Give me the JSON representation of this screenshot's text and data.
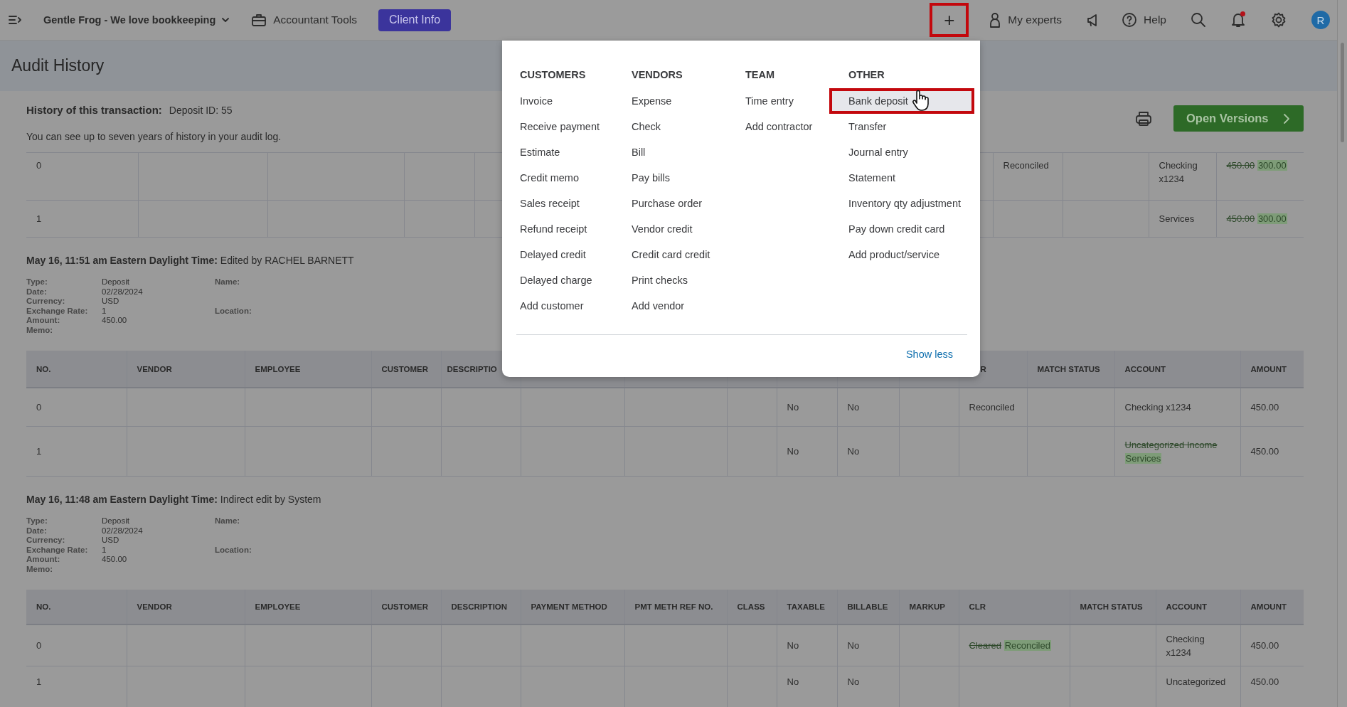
{
  "top_bar": {
    "company": "Gentle Frog - We love bookkeeping",
    "tools": "Accountant Tools",
    "client_button": "Client Info",
    "new_button": {
      "label": "+",
      "highlighted": true
    },
    "experts": "My experts",
    "help": "Help",
    "has_notification": true,
    "avatar": "R"
  },
  "page": {
    "title": "Audit History"
  },
  "history": {
    "label": "History of this transaction:",
    "id": "Deposit ID: 55",
    "note": "You can see up to seven years of history in your audit log.",
    "open_button": "Open Versions"
  },
  "first_table": {
    "rows": [
      [
        "0",
        null,
        null,
        null,
        null,
        "Reconciled",
        null,
        "Checking x1234",
        {
          "old": "450.00",
          "new": "300.00"
        }
      ],
      [
        "1",
        null,
        null,
        null,
        null,
        null,
        null,
        "Services",
        {
          "old": "450.00",
          "new": "300.00"
        }
      ]
    ]
  },
  "entries": [
    {
      "heading": "**May 16, 11:51 am Eastern Daylight Time:** Edited by RACHEL BARNETT",
      "details": [
        {
          "label": "Type:",
          "value": "Deposit",
          "aside": "Name:"
        },
        {
          "label": "Date:",
          "value": "02/28/2024"
        },
        {
          "label": "Currency:",
          "value": "USD"
        },
        {
          "label": "Exchange Rate:",
          "value": "1",
          "aside": "Location:"
        },
        {
          "label": "Amount:",
          "value": "450.00"
        },
        {
          "label": "Memo:"
        }
      ],
      "table": {
        "columns": [
          "NO.",
          "VENDOR",
          "EMPLOYEE",
          "CUSTOMER",
          "DESCRIPTIO",
          null,
          null,
          null,
          null,
          null,
          null,
          "R",
          "MATCH STATUS",
          "ACCOUNT",
          "AMOUNT"
        ],
        "rows": [
          [
            "0",
            null,
            null,
            null,
            null,
            null,
            null,
            null,
            "No",
            "No",
            null,
            "Reconciled",
            null,
            "Checking x1234",
            "450.00"
          ],
          [
            "1",
            null,
            null,
            null,
            null,
            null,
            null,
            null,
            "No",
            "No",
            null,
            null,
            null,
            {
              "old": "Uncategorized Income",
              "new": "Services"
            },
            "450.00"
          ]
        ]
      }
    },
    {
      "heading": "**May 16, 11:48 am Eastern Daylight Time:** Indirect edit by System",
      "details": [
        {
          "label": "Type:",
          "value": "Deposit",
          "aside": "Name:"
        },
        {
          "label": "Date:",
          "value": "02/28/2024"
        },
        {
          "label": "Currency:",
          "value": "USD"
        },
        {
          "label": "Exchange Rate:",
          "value": "1",
          "aside": "Location:"
        },
        {
          "label": "Amount:",
          "value": "450.00"
        },
        {
          "label": "Memo:"
        }
      ],
      "table": {
        "columns": [
          "NO.",
          "VENDOR",
          "EMPLOYEE",
          "CUSTOMER",
          "DESCRIPTION",
          "PAYMENT METHOD",
          "PMT METH REF NO.",
          "CLASS",
          "TAXABLE",
          "BILLABLE",
          "MARKUP",
          "CLR",
          "MATCH STATUS",
          "ACCOUNT",
          "AMOUNT"
        ],
        "rows": [
          [
            "0",
            null,
            null,
            null,
            null,
            null,
            null,
            null,
            "No",
            "No",
            null,
            {
              "old": "Cleared",
              "new": "Reconciled"
            },
            null,
            "Checking x1234",
            "450.00"
          ],
          [
            "1",
            null,
            null,
            null,
            null,
            null,
            null,
            null,
            "No",
            "No",
            null,
            null,
            null,
            "Uncategorized",
            "450.00"
          ]
        ]
      }
    }
  ],
  "new_menu": {
    "sections": [
      {
        "heading": "CUSTOMERS",
        "items": [
          {
            "label": "Invoice",
            "selected": false
          },
          {
            "label": "Receive payment",
            "selected": false
          },
          {
            "label": "Estimate",
            "selected": false
          },
          {
            "label": "Credit memo",
            "selected": false
          },
          {
            "label": "Sales receipt",
            "selected": false
          },
          {
            "label": "Refund receipt",
            "selected": false
          },
          {
            "label": "Delayed credit",
            "selected": false
          },
          {
            "label": "Delayed charge",
            "selected": false
          },
          {
            "label": "Add customer",
            "selected": false
          }
        ]
      },
      {
        "heading": "VENDORS",
        "items": [
          {
            "label": "Expense",
            "selected": false
          },
          {
            "label": "Check",
            "selected": false
          },
          {
            "label": "Bill",
            "selected": false
          },
          {
            "label": "Pay bills",
            "selected": false
          },
          {
            "label": "Purchase order",
            "selected": false
          },
          {
            "label": "Vendor credit",
            "selected": false
          },
          {
            "label": "Credit card credit",
            "selected": false
          },
          {
            "label": "Print checks",
            "selected": false
          },
          {
            "label": "Add vendor",
            "selected": false
          }
        ]
      },
      {
        "heading": "TEAM",
        "items": [
          {
            "label": "Time entry",
            "selected": false
          },
          {
            "label": "Add contractor",
            "selected": false
          }
        ]
      },
      {
        "heading": "OTHER",
        "items": [
          {
            "label": "Bank deposit",
            "selected": true,
            "highlighted": true
          },
          {
            "label": "Transfer",
            "selected": false
          },
          {
            "label": "Journal entry",
            "selected": false
          },
          {
            "label": "Statement",
            "selected": false
          },
          {
            "label": "Inventory qty adjustment",
            "selected": false
          },
          {
            "label": "Pay down credit card",
            "selected": false
          },
          {
            "label": "Add product/service",
            "selected": false
          }
        ]
      }
    ],
    "footer_link": "Show less"
  }
}
